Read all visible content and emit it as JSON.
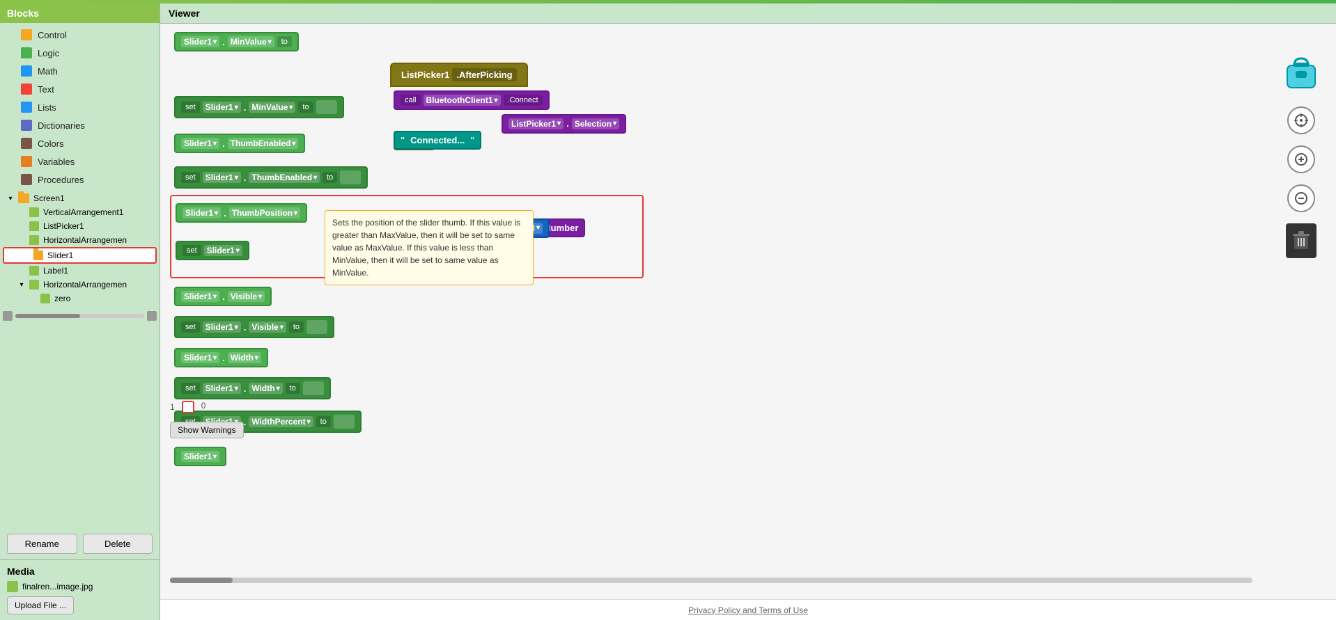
{
  "topBar": {
    "color": "#8bc34a"
  },
  "sidebar": {
    "title": "Blocks",
    "categories": [
      {
        "id": "control",
        "label": "Control",
        "color": "#f5a623"
      },
      {
        "id": "logic",
        "label": "Logic",
        "color": "#4CAF50"
      },
      {
        "id": "math",
        "label": "Math",
        "color": "#2196F3"
      },
      {
        "id": "text",
        "label": "Text",
        "color": "#f44336"
      },
      {
        "id": "lists",
        "label": "Lists",
        "color": "#2196F3"
      },
      {
        "id": "dictionaries",
        "label": "Dictionaries",
        "color": "#5c6bc0"
      },
      {
        "id": "colors",
        "label": "Colors",
        "color": "#795548"
      },
      {
        "id": "variables",
        "label": "Variables",
        "color": "#e67e22"
      },
      {
        "id": "procedures",
        "label": "Procedures",
        "color": "#795548"
      }
    ],
    "tree": {
      "screen1": {
        "label": "Screen1",
        "expanded": true,
        "children": [
          {
            "id": "vertical-arrangement1",
            "label": "VerticalArrangement1",
            "type": "component"
          },
          {
            "id": "list-picker1",
            "label": "ListPicker1",
            "type": "component"
          },
          {
            "id": "horizontal-arrangement1",
            "label": "HorizontalArrangemen",
            "type": "component"
          },
          {
            "id": "slider1",
            "label": "Slider1",
            "type": "component",
            "selected": true
          },
          {
            "id": "label1",
            "label": "Label1",
            "type": "component"
          },
          {
            "id": "horizontal-arrangement2",
            "label": "HorizontalArrangemen",
            "type": "component",
            "expanded": true,
            "children": [
              {
                "id": "zero",
                "label": "zero",
                "type": "component"
              }
            ]
          }
        ]
      }
    },
    "buttons": {
      "rename": "Rename",
      "delete": "Delete"
    }
  },
  "media": {
    "title": "Media",
    "file": "finalren...image.jpg",
    "uploadButton": "Upload File ..."
  },
  "viewer": {
    "title": "Viewer",
    "tooltip": {
      "text": "Sets the position of the slider thumb. If this value is greater than MaxValue, then it will be set to same value as MaxValue. If this value is less than MinValue, then it will be set to same value as MinValue."
    },
    "scrollbarLabel": "",
    "footer": "Privacy Policy and Terms of Use"
  },
  "blocks": {
    "slider1MinValue": "Slider1 ▾ . MinValue ▾",
    "slider1MinValueSet": "set Slider1 ▾ . MinValue ▾ to",
    "slider1ThumbEnabled": "Slider1 ▾ . ThumbEnabled ▾",
    "slider1ThumbEnabledSet": "set Slider1 ▾ . ThumbEnabled ▾ to",
    "slider1ThumbPosition": "Slider1 ▾ . ThumbPosition ▾",
    "slider1ThumbPositionSet": "set Slider1 ▾",
    "slider1Visible": "Slider1 ▾ . Visible ▾",
    "slider1VisibleSet": "set Slider1 ▾ . Visible ▾ to",
    "slider1Width": "Slider1 ▾ . Width ▾",
    "slider1WidthSet": "set Slider1 ▾ . Width ▾ to",
    "slider1WidthPercentSet": "set Slider1 ▾ . WidthPercent ▾ to",
    "slider1Last": "Slider1 ▾"
  },
  "rightTools": {
    "backpack": "backpack",
    "crosshair": "crosshair",
    "zoomIn": "+",
    "zoomOut": "-",
    "trash": "trash"
  }
}
